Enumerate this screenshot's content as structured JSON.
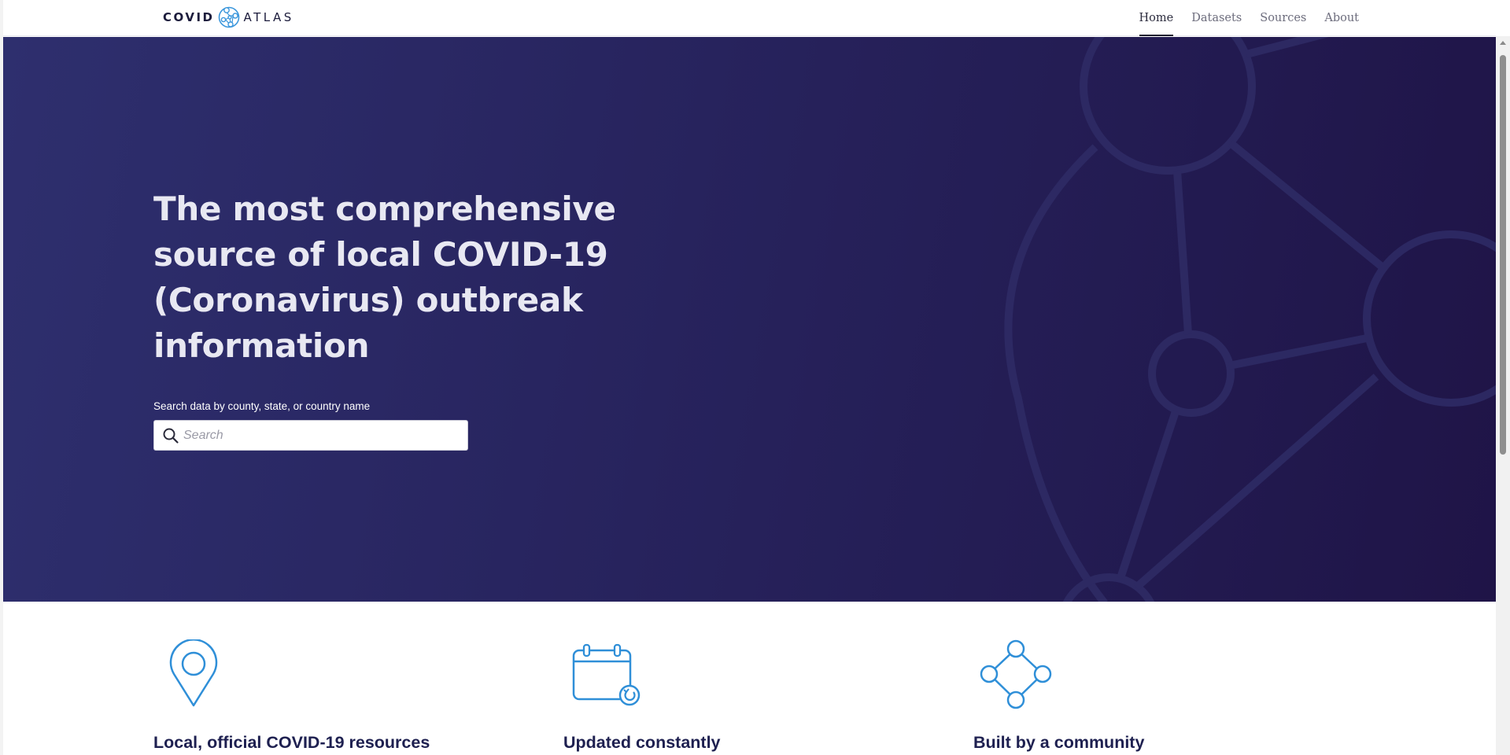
{
  "logo": {
    "word1": "COVID",
    "word2": "ATLAS"
  },
  "nav": {
    "items": [
      {
        "label": "Home",
        "active": true
      },
      {
        "label": "Datasets",
        "active": false
      },
      {
        "label": "Sources",
        "active": false
      },
      {
        "label": "About",
        "active": false
      }
    ]
  },
  "hero": {
    "title": "The most comprehensive source of local COVID-19 (Coronavirus) outbreak information",
    "search_label": "Search data by county, state, or country name",
    "search_placeholder": "Search",
    "search_value": ""
  },
  "features": [
    {
      "icon": "map-pin-icon",
      "title": "Local, official COVID-19 resources"
    },
    {
      "icon": "calendar-refresh-icon",
      "title": "Updated constantly"
    },
    {
      "icon": "community-network-icon",
      "title": "Built by a community"
    }
  ],
  "colors": {
    "hero_gradient_start": "#2e2f6e",
    "hero_gradient_end": "#1f1447",
    "accent_blue": "#2f8fd8",
    "heading_navy": "#1e2050"
  }
}
